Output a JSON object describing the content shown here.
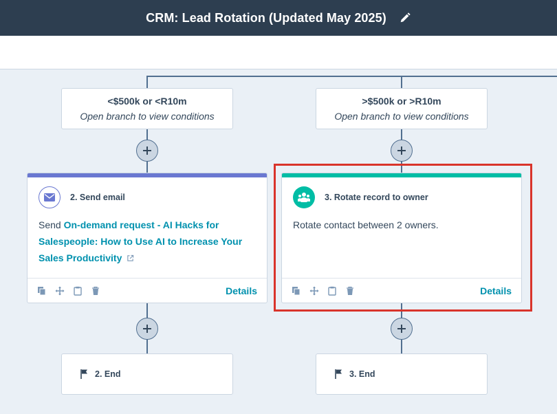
{
  "header": {
    "title": "CRM: Lead Rotation (Updated May 2025)",
    "edit_icon": "pencil-icon"
  },
  "branches": [
    {
      "title": "<$500k or <R10m",
      "subtitle": "Open branch to view conditions"
    },
    {
      "title": ">$500k or >R10m",
      "subtitle": "Open branch to view conditions"
    }
  ],
  "actions": [
    {
      "header": "2. Send email",
      "icon": "envelope-icon",
      "accent": "#6a78d1",
      "prefix": "Send ",
      "link": "On-demand request - AI Hacks for Salespeople: How to Use AI to Increase Your Sales Productivity",
      "details": "Details"
    },
    {
      "header": "3. Rotate record to owner",
      "icon": "people-icon",
      "accent": "#00bda5",
      "body": "Rotate contact between 2 owners.",
      "details": "Details"
    }
  ],
  "ends": [
    {
      "label": "2. End",
      "icon": "flag-icon"
    },
    {
      "label": "3. End",
      "icon": "flag-icon"
    }
  ],
  "colors": {
    "header_bg": "#2d3e50",
    "link": "#0091ae",
    "highlight": "#d9342b",
    "canvas": "#eaf0f6"
  }
}
